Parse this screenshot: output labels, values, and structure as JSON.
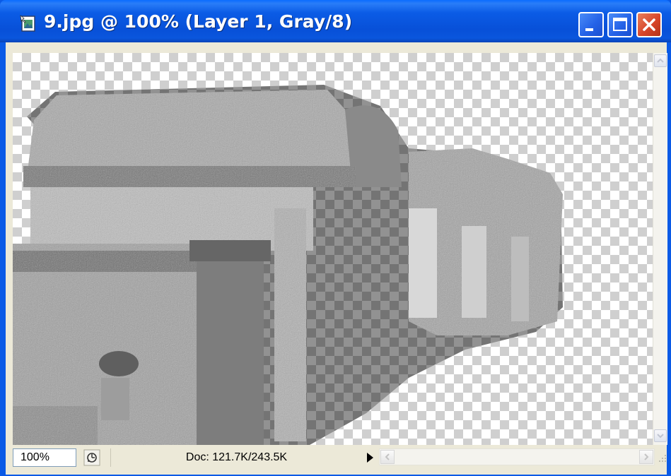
{
  "window": {
    "title": "9.jpg @ 100% (Layer 1, Gray/8)",
    "icons": {
      "doc": "photoshop-document-icon",
      "minimize": "minimize-icon",
      "maximize": "maximize-icon",
      "close": "close-icon"
    }
  },
  "status_bar": {
    "zoom_value": "100%",
    "doc_info": "Doc: 121.7K/243.5K",
    "menu_icon": "status-menu-icon",
    "arrow_icon": "triangle-right-icon"
  },
  "colors": {
    "titlebar": "#0a5ae6",
    "close_button": "#d8462a",
    "chrome": "#ece9d8",
    "checker_dark": "#cfcfcf"
  }
}
